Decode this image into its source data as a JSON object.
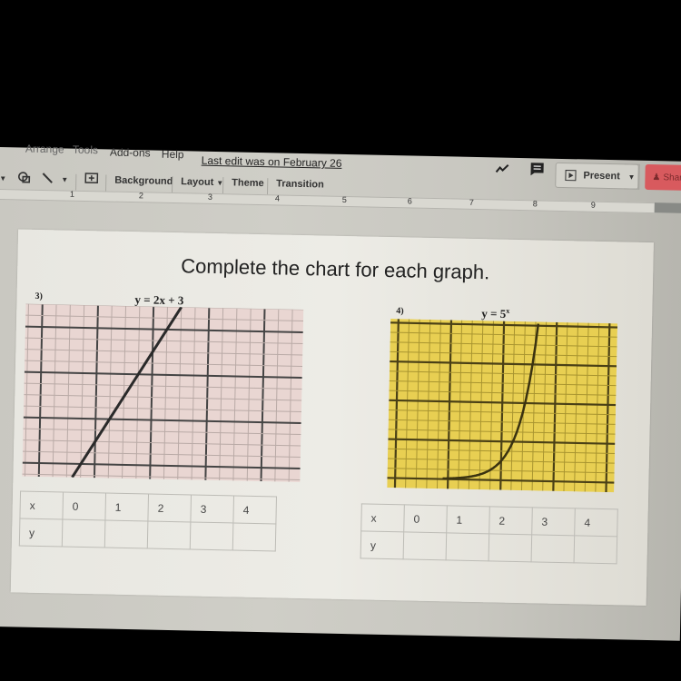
{
  "menubar": {
    "items": [
      "Arrange",
      "Tools",
      "Add-ons",
      "Help"
    ],
    "last_edit": "Last edit was on February 26",
    "present_label": "Present",
    "share_label": "Share"
  },
  "icons": {
    "activity": "trending-up-icon",
    "comments": "comment-icon",
    "present": "play-icon",
    "share": "person-icon"
  },
  "toolbar": {
    "background_label": "Background",
    "layout_label": "Layout",
    "theme_label": "Theme",
    "transition_label": "Transition"
  },
  "ruler": {
    "numbers": [
      "1",
      "2",
      "3",
      "4",
      "5",
      "6",
      "7",
      "8",
      "9"
    ]
  },
  "slide": {
    "title": "Complete the chart for each graph.",
    "graphs": [
      {
        "number": "3)",
        "equation": "y = 2x + 3",
        "background": "#e9d6d2",
        "table": {
          "x_label": "x",
          "y_label": "y",
          "x_values": [
            "0",
            "1",
            "2",
            "3",
            "4"
          ],
          "y_values": [
            "",
            "",
            "",
            "",
            ""
          ]
        }
      },
      {
        "number": "4)",
        "equation_base": "y = 5",
        "equation_exp": "x",
        "background": "#e8cf52",
        "table": {
          "x_label": "x",
          "y_label": "y",
          "x_values": [
            "0",
            "1",
            "2",
            "3",
            "4"
          ],
          "y_values": [
            "",
            "",
            "",
            "",
            ""
          ]
        }
      }
    ]
  },
  "colors": {
    "share_red": "#d85a5e",
    "graph_line": "#333333",
    "graph_yellow": "#e8cf52",
    "graph_pink": "#e9d6d2"
  }
}
